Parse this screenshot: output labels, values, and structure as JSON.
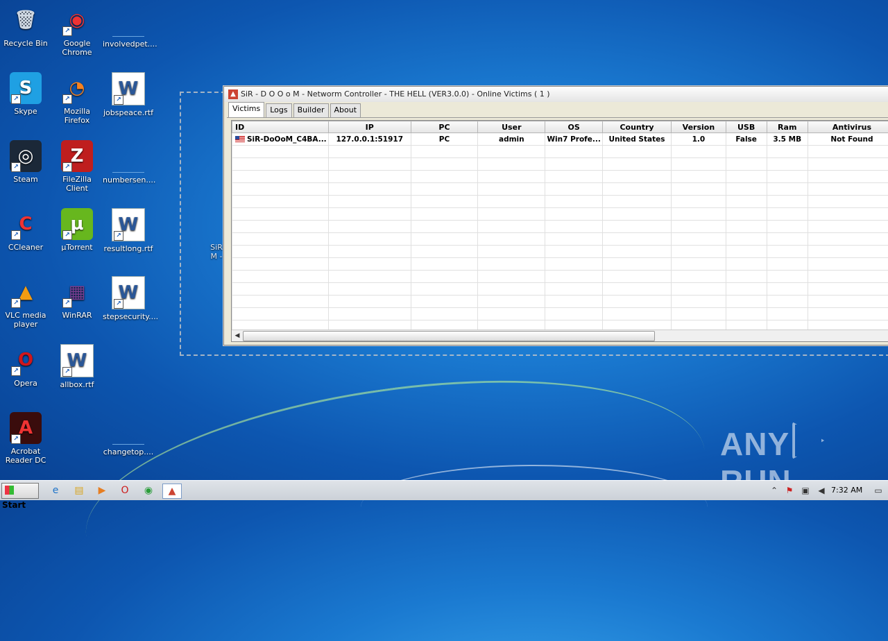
{
  "desktop": {
    "icons": [
      {
        "label": "Recycle Bin",
        "icon": "recycle-bin-icon"
      },
      {
        "label": "Google Chrome",
        "icon": "chrome-icon"
      },
      {
        "label": "involvedpet....",
        "icon": "file-icon"
      },
      {
        "label": "Skype",
        "icon": "skype-icon"
      },
      {
        "label": "Mozilla Firefox",
        "icon": "firefox-icon"
      },
      {
        "label": "jobspeace.rtf",
        "icon": "word-doc-icon"
      },
      {
        "label": "Steam",
        "icon": "steam-icon"
      },
      {
        "label": "FileZilla Client",
        "icon": "filezilla-icon"
      },
      {
        "label": "numbersen....",
        "icon": "file-icon"
      },
      {
        "label": "CCleaner",
        "icon": "ccleaner-icon"
      },
      {
        "label": "µTorrent",
        "icon": "utorrent-icon"
      },
      {
        "label": "resultlong.rtf",
        "icon": "word-doc-icon"
      },
      {
        "label": "VLC media player",
        "icon": "vlc-icon"
      },
      {
        "label": "WinRAR",
        "icon": "winrar-icon"
      },
      {
        "label": "stepsecurity....",
        "icon": "word-doc-icon"
      },
      {
        "label": "Opera",
        "icon": "opera-icon"
      },
      {
        "label": "allbox.rtf",
        "icon": "word-doc-icon"
      },
      {
        "label": "Acrobat Reader DC",
        "icon": "acrobat-icon"
      },
      {
        "label": "changetop....",
        "icon": "file-icon"
      }
    ],
    "partial_icon_text": "SiR\nM -"
  },
  "window": {
    "title": "SiR - D O O o M - Networm Controller - THE HELL (VER3.0.0) - Online Victims ( 1 )",
    "tabs": [
      "Victims",
      "Logs",
      "Builder",
      "About"
    ],
    "active_tab": "Victims",
    "columns": [
      "ID",
      "IP",
      "PC",
      "User",
      "OS",
      "Country",
      "Version",
      "USB",
      "Ram",
      "Antivirus"
    ],
    "rows": [
      {
        "ID": "SiR-DoOoM_C4BA...",
        "IP": "127.0.0.1:51917",
        "PC": "PC",
        "User": "admin",
        "OS": "Win7 Profe...",
        "Country": "United States",
        "Version": "1.0",
        "USB": "False",
        "Ram": "3.5 MB",
        "Antivirus": "Not Found"
      }
    ]
  },
  "taskbar": {
    "start_label": "Start",
    "pinned": [
      "ie-icon",
      "explorer-icon",
      "media-player-icon",
      "opera-icon",
      "chrome-icon",
      "sir-doom-app-icon"
    ],
    "tray": [
      "show-hidden-icon",
      "action-center-icon",
      "network-icon",
      "volume-icon"
    ],
    "clock": "7:32 AM"
  },
  "watermark": {
    "left": "ANY",
    "right": "RUN"
  }
}
